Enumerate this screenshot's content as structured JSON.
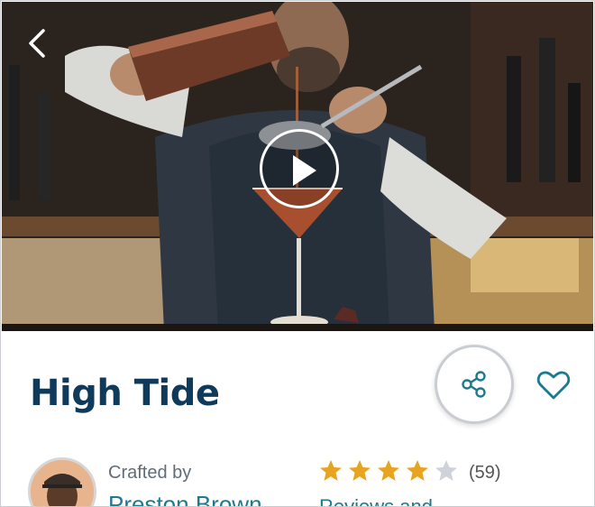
{
  "hero": {
    "media_icon": "play-icon",
    "back_icon": "chevron-left-icon"
  },
  "recipe": {
    "title": "High Tide"
  },
  "actions": {
    "share_icon": "share-icon",
    "favorite_icon": "heart-icon"
  },
  "author": {
    "crafted_label": "Crafted by",
    "name": "Preston Brown"
  },
  "rating": {
    "stars_filled": 4,
    "stars_total": 5,
    "count_label": "(59)",
    "reviews_link": "Reviews and..."
  },
  "colors": {
    "title": "#0e3a5c",
    "accent": "#1c7a8e",
    "star_filled": "#e8a41f",
    "star_empty": "#cdd3d9"
  }
}
